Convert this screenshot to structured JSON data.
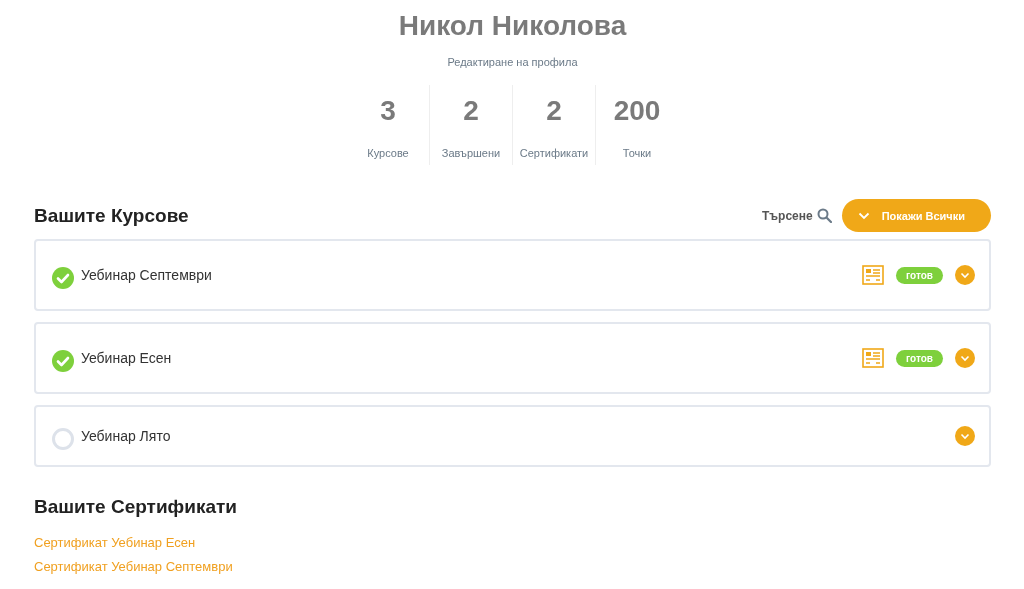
{
  "profile": {
    "name": "Никол Николова",
    "edit_link": "Редактиране на профила"
  },
  "stats": [
    {
      "value": "3",
      "label": "Курсове"
    },
    {
      "value": "2",
      "label": "Завършени"
    },
    {
      "value": "2",
      "label": "Сертификати"
    },
    {
      "value": "200",
      "label": "Точки"
    }
  ],
  "courses_section": {
    "title": "Вашите Курсове",
    "search_label": "Търсене",
    "show_all_button": "Покажи Всички"
  },
  "courses": [
    {
      "title": "Уебинар Септември",
      "completed": true,
      "badge": "готов"
    },
    {
      "title": "Уебинар Есен",
      "completed": true,
      "badge": "готов"
    },
    {
      "title": "Уебинар Лято",
      "completed": false
    }
  ],
  "certificates_section": {
    "title": "Вашите Сертификати"
  },
  "certificates": [
    "Сертификат Уебинар Есен",
    "Сертификат Уебинар Септември"
  ]
}
